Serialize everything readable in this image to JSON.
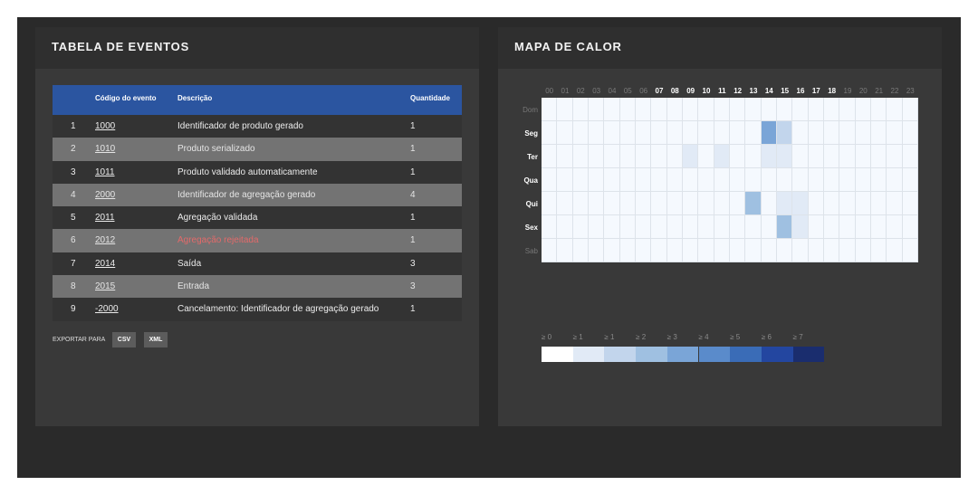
{
  "events_panel": {
    "title": "TABELA DE EVENTOS",
    "columns": {
      "index": "",
      "code": "Código do evento",
      "description": "Descrição",
      "quantity": "Quantidade"
    },
    "rows": [
      {
        "index": "1",
        "code": "1000",
        "description": "Identificador de produto gerado",
        "quantity": "1",
        "status": "normal"
      },
      {
        "index": "2",
        "code": "1010",
        "description": "Produto serializado",
        "quantity": "1",
        "status": "normal"
      },
      {
        "index": "3",
        "code": "1011",
        "description": "Produto validado automaticamente",
        "quantity": "1",
        "status": "normal"
      },
      {
        "index": "4",
        "code": "2000",
        "description": "Identificador de agregação gerado",
        "quantity": "4",
        "status": "normal"
      },
      {
        "index": "5",
        "code": "2011",
        "description": "Agregação validada",
        "quantity": "1",
        "status": "normal"
      },
      {
        "index": "6",
        "code": "2012",
        "description": "Agregação rejeitada",
        "quantity": "1",
        "status": "rejected"
      },
      {
        "index": "7",
        "code": "2014",
        "description": "Saída",
        "quantity": "3",
        "status": "normal"
      },
      {
        "index": "8",
        "code": "2015",
        "description": "Entrada",
        "quantity": "3",
        "status": "normal"
      },
      {
        "index": "9",
        "code": "-2000",
        "description": "Cancelamento: Identificador de agregação gerado",
        "quantity": "1",
        "status": "normal"
      }
    ],
    "export": {
      "label": "EXPORTAR PARA",
      "csv": "CSV",
      "xml": "XML"
    },
    "colors": {
      "header": "#2b55a0",
      "rejected_text": "#e36a6a"
    }
  },
  "heatmap_panel": {
    "title": "MAPA DE CALOR",
    "hours": [
      "00",
      "01",
      "02",
      "03",
      "04",
      "05",
      "06",
      "07",
      "08",
      "09",
      "10",
      "11",
      "12",
      "13",
      "14",
      "15",
      "16",
      "17",
      "18",
      "19",
      "20",
      "21",
      "22",
      "23"
    ],
    "active_hours": [
      "07",
      "08",
      "09",
      "10",
      "11",
      "12",
      "13",
      "14",
      "15",
      "16",
      "17",
      "18"
    ],
    "days": [
      {
        "label": "Dom",
        "active": false
      },
      {
        "label": "Seg",
        "active": true
      },
      {
        "label": "Ter",
        "active": true
      },
      {
        "label": "Qua",
        "active": true
      },
      {
        "label": "Qui",
        "active": true
      },
      {
        "label": "Sex",
        "active": true
      },
      {
        "label": "Sab",
        "active": false
      }
    ],
    "cells": [
      {
        "day": "Seg",
        "hour": "14",
        "level": 4
      },
      {
        "day": "Seg",
        "hour": "15",
        "level": 2
      },
      {
        "day": "Ter",
        "hour": "09",
        "level": 1
      },
      {
        "day": "Ter",
        "hour": "11",
        "level": 1
      },
      {
        "day": "Ter",
        "hour": "14",
        "level": 1
      },
      {
        "day": "Ter",
        "hour": "15",
        "level": 1
      },
      {
        "day": "Qui",
        "hour": "13",
        "level": 3
      },
      {
        "day": "Qui",
        "hour": "15",
        "level": 1
      },
      {
        "day": "Qui",
        "hour": "16",
        "level": 1
      },
      {
        "day": "Sex",
        "hour": "15",
        "level": 3
      },
      {
        "day": "Sex",
        "hour": "16",
        "level": 1
      }
    ],
    "legend": {
      "labels": [
        "≥ 0",
        "≥ 1",
        "≥ 1",
        "≥ 2",
        "≥ 3",
        "≥ 4",
        "≥ 5",
        "≥ 6",
        "≥ 7"
      ],
      "colors": [
        "#ffffff",
        "#e1eaf6",
        "#c2d5ec",
        "#9fc0e1",
        "#7aa5d7",
        "#5a8bcb",
        "#3a6cb7",
        "#2346a0",
        "#1a2d6e"
      ]
    }
  }
}
